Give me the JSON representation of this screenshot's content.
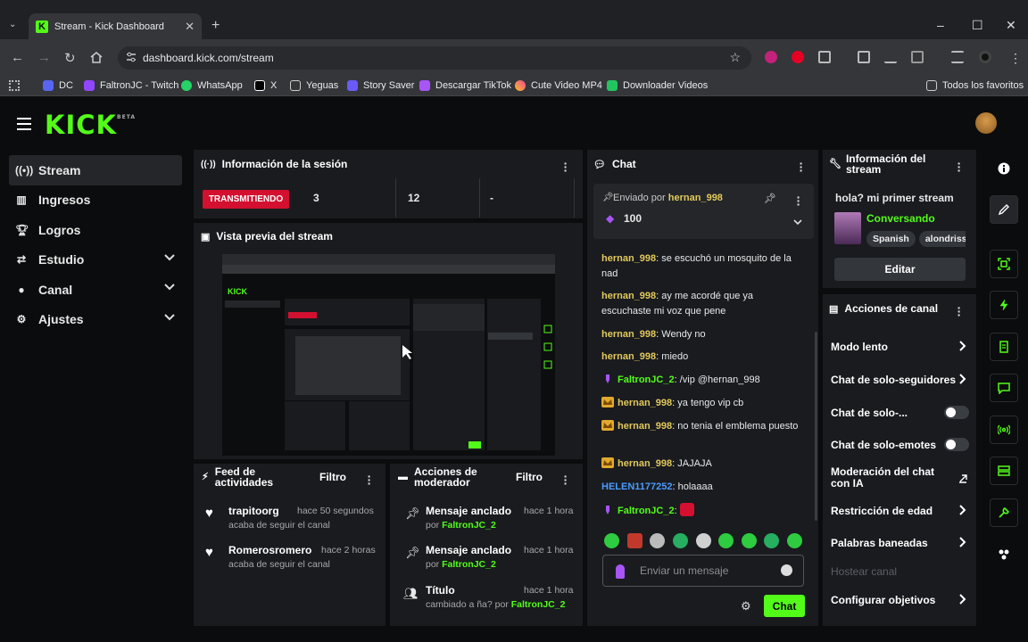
{
  "browser": {
    "tab_title": "Stream - Kick Dashboard",
    "url": "dashboard.kick.com/stream",
    "bookmarks": [
      "DC",
      "FaltronJC - Twitch",
      "WhatsApp",
      "X",
      "Yeguas",
      "Story Saver",
      "Descargar TikTok",
      "Cute Video MP4",
      "Downloader Videos"
    ],
    "all_bookmarks": "Todos los favoritos"
  },
  "logo": {
    "text": "KICK",
    "beta": "BETA"
  },
  "sidebar": {
    "items": [
      {
        "label": "Stream",
        "icon": "broadcast-icon"
      },
      {
        "label": "Ingresos",
        "icon": "chart-icon"
      },
      {
        "label": "Logros",
        "icon": "trophy-icon"
      },
      {
        "label": "Estudio",
        "icon": "studio-icon"
      },
      {
        "label": "Canal",
        "icon": "user-icon"
      },
      {
        "label": "Ajustes",
        "icon": "gear-icon"
      }
    ]
  },
  "session": {
    "title": "Información de la sesión",
    "status": "TRANSMITIENDO",
    "stats": [
      "3",
      "12",
      "-"
    ]
  },
  "preview": {
    "title": "Vista previa del stream"
  },
  "feed": {
    "title": "Feed de actividades",
    "filter": "Filtro",
    "items": [
      {
        "name": "trapitoorg",
        "time": "hace 50 segundos",
        "sub": "acaba de seguir el canal"
      },
      {
        "name": "Romerosromero",
        "time": "hace 2 horas",
        "sub": "acaba de seguir el canal"
      }
    ]
  },
  "mod": {
    "title": "Acciones de moderador",
    "filter": "Filtro",
    "items": [
      {
        "title": "Mensaje anclado",
        "time": "hace 1 hora",
        "by": "por",
        "user": "FaltronJC_2"
      },
      {
        "title": "Mensaje anclado",
        "time": "hace 1 hora",
        "by": "por",
        "user": "FaltronJC_2"
      },
      {
        "title": "Título",
        "time": "hace 1 hora",
        "by": "cambiado a ña? por",
        "user": "FaltronJC_2"
      }
    ]
  },
  "chat": {
    "title": "Chat",
    "pinned": {
      "label": "Enviado por",
      "user": "hernan_998",
      "amount": "100"
    },
    "messages": [
      {
        "user": "hernan_998",
        "text": "se escuchó un mosquito de la nad"
      },
      {
        "user": "hernan_998",
        "text": "ay me acordé que ya escuchaste mi voz que pene"
      },
      {
        "user": "hernan_998",
        "text": "Wendy no"
      },
      {
        "user": "hernan_998",
        "text": "miedo"
      },
      {
        "user": "FaltronJC_2",
        "text": "/vip @hernan_998"
      },
      {
        "user": "hernan_998",
        "text": "ya tengo vip cb"
      },
      {
        "user": "hernan_998",
        "text": "no tenia el emblema puesto"
      },
      {
        "user": "hernan_998",
        "text": "JAJAJA"
      },
      {
        "user": "HELEN1177252",
        "text": "holaaaa"
      },
      {
        "user": "FaltronJC_2",
        "text": ""
      }
    ],
    "placeholder": "Enviar un mensaje",
    "send": "Chat"
  },
  "stream_info": {
    "title": "Información del stream",
    "stream_title": "hola? mi primer stream",
    "category": "Conversando",
    "tags": [
      "Spanish",
      "alondrissa"
    ],
    "edit": "Editar"
  },
  "channel_actions": {
    "title": "Acciones de canal",
    "items": [
      "Modo lento",
      "Chat de solo-seguidores",
      "Chat de solo-...",
      "Chat de solo-emotes",
      "Moderación del chat con IA",
      "Restricción de edad",
      "Palabras baneadas",
      "Hostear canal",
      "Configurar objetivos"
    ]
  },
  "colors": {
    "accent": "#53fc18",
    "live": "#d3102f",
    "chat_user": "#e3c95b",
    "panel": "#191b1f"
  }
}
